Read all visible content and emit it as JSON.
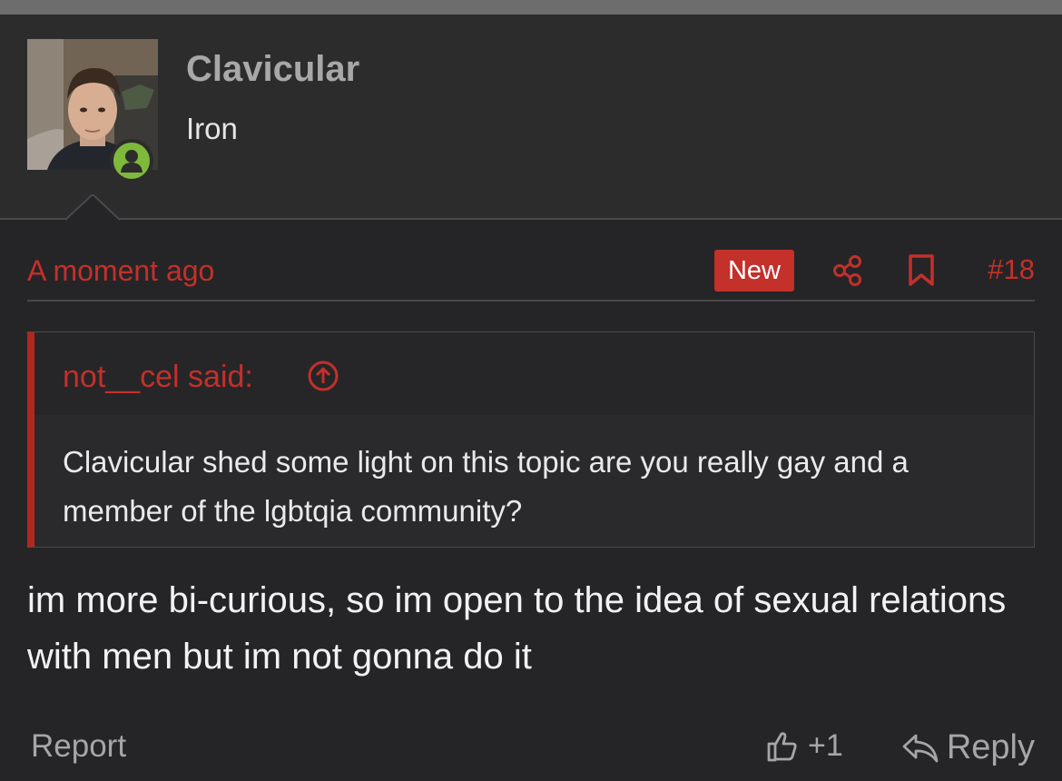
{
  "colors": {
    "accent": "#c4302a",
    "online": "#7fb93c",
    "background": "#252527"
  },
  "user": {
    "name": "Clavicular",
    "title": "Iron"
  },
  "post": {
    "time": "A moment ago",
    "new_badge": "New",
    "number": "#18",
    "quote": {
      "author": "not__cel said:",
      "text": "Clavicular shed some light on this topic are you really gay and a member of the lgbtqia community?"
    },
    "message": "im more bi-curious, so im open to the idea of sexual relations with men but im not gonna do it"
  },
  "actions": {
    "report": "Report",
    "like": "+1",
    "reply": "Reply"
  },
  "icons": [
    "user-online-icon",
    "share-icon",
    "bookmark-icon",
    "quote-jump-up-icon",
    "thumbs-up-icon",
    "reply-icon"
  ]
}
